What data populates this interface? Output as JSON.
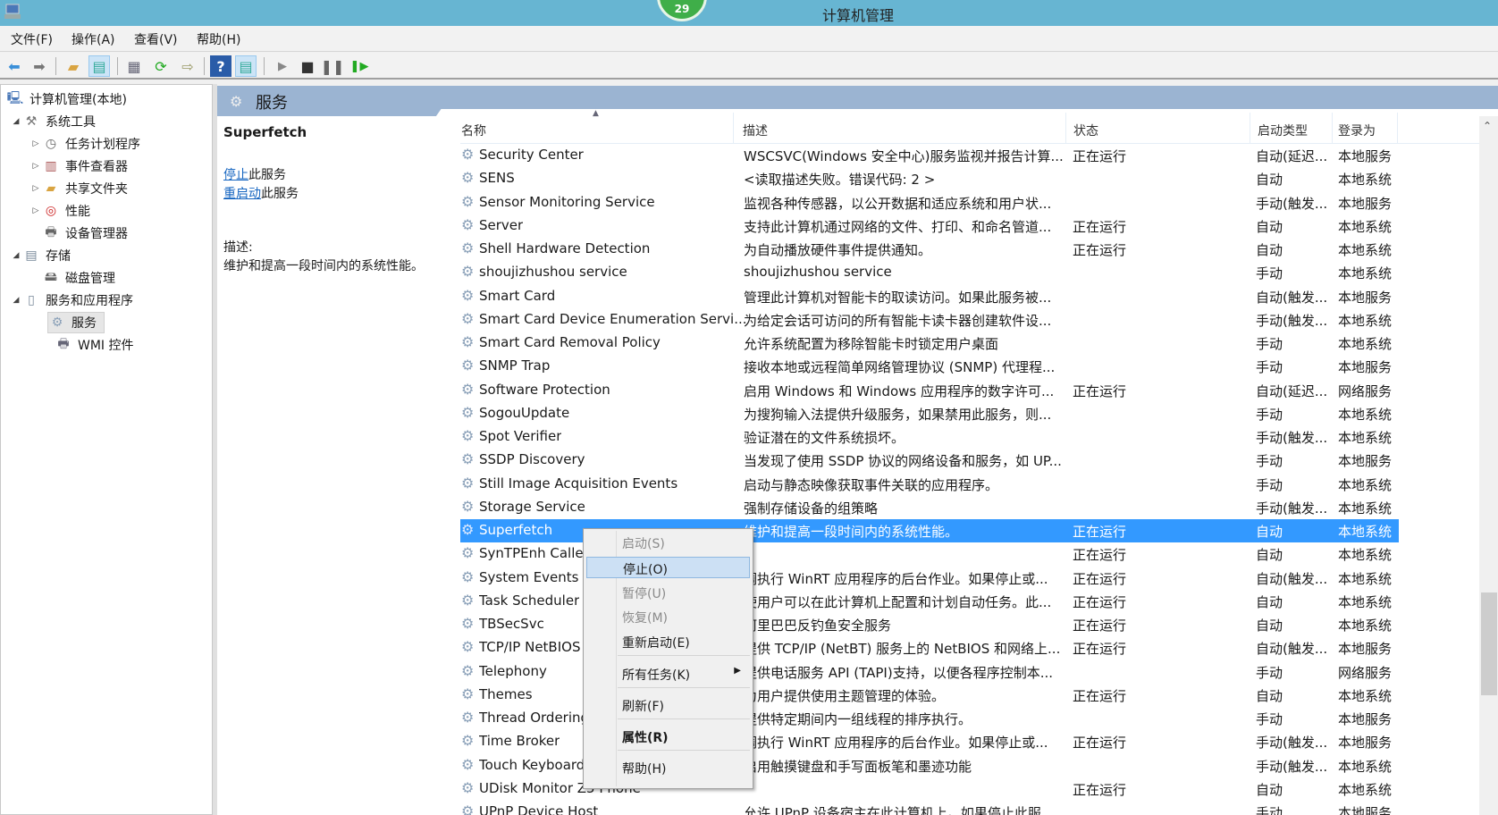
{
  "window": {
    "title": "计算机管理",
    "badge": "29"
  },
  "menu": [
    "文件(F)",
    "操作(A)",
    "查看(V)",
    "帮助(H)"
  ],
  "toolbar": [
    "back-icon",
    "forward-icon",
    "up-folder-icon",
    "show-hide-tree-icon",
    "properties-icon",
    "refresh-icon",
    "export-icon",
    "help-icon",
    "show-action-pane-icon",
    "start-service-icon",
    "stop-service-icon",
    "pause-service-icon",
    "restart-service-icon"
  ],
  "tree": {
    "root": "计算机管理(本地)",
    "items": [
      {
        "label": "系统工具",
        "level": 1,
        "expand": "open"
      },
      {
        "label": "任务计划程序",
        "level": 2,
        "expand": "closed"
      },
      {
        "label": "事件查看器",
        "level": 2,
        "expand": "closed"
      },
      {
        "label": "共享文件夹",
        "level": 2,
        "expand": "closed"
      },
      {
        "label": "性能",
        "level": 2,
        "expand": "closed"
      },
      {
        "label": "设备管理器",
        "level": 2,
        "expand": ""
      },
      {
        "label": "存储",
        "level": 1,
        "expand": "open"
      },
      {
        "label": "磁盘管理",
        "level": 2,
        "expand": ""
      },
      {
        "label": "服务和应用程序",
        "level": 1,
        "expand": "open"
      },
      {
        "label": "服务",
        "level": 2,
        "expand": "",
        "selected": true
      },
      {
        "label": "WMI 控件",
        "level": 2,
        "expand": ""
      }
    ]
  },
  "header": {
    "title": "服务"
  },
  "detail": {
    "service_name": "Superfetch",
    "stop_link": "停止",
    "stop_suffix": "此服务",
    "restart_link": "重启动",
    "restart_suffix": "此服务",
    "desc_label": "描述:",
    "desc": "维护和提高一段时间内的系统性能。"
  },
  "columns": {
    "name": "名称",
    "desc": "描述",
    "status": "状态",
    "startup": "启动类型",
    "logon": "登录为"
  },
  "rows": [
    {
      "name": "Security Center",
      "desc": "WSCSVC(Windows 安全中心)服务监视并报告计算...",
      "status": "正在运行",
      "startup": "自动(延迟...",
      "logon": "本地服务"
    },
    {
      "name": "SENS",
      "desc": "<读取描述失败。错误代码: 2 >",
      "status": "",
      "startup": "自动",
      "logon": "本地系统"
    },
    {
      "name": "Sensor Monitoring Service",
      "desc": "监视各种传感器，以公开数据和适应系统和用户状...",
      "status": "",
      "startup": "手动(触发...",
      "logon": "本地服务"
    },
    {
      "name": "Server",
      "desc": "支持此计算机通过网络的文件、打印、和命名管道...",
      "status": "正在运行",
      "startup": "自动",
      "logon": "本地系统"
    },
    {
      "name": "Shell Hardware Detection",
      "desc": "为自动播放硬件事件提供通知。",
      "status": "正在运行",
      "startup": "自动",
      "logon": "本地系统"
    },
    {
      "name": "shoujizhushou service",
      "desc": "shoujizhushou service",
      "status": "",
      "startup": "手动",
      "logon": "本地系统"
    },
    {
      "name": "Smart Card",
      "desc": "管理此计算机对智能卡的取读访问。如果此服务被...",
      "status": "",
      "startup": "自动(触发...",
      "logon": "本地服务"
    },
    {
      "name": "Smart Card Device Enumeration Servi...",
      "desc": "为给定会话可访问的所有智能卡读卡器创建软件设...",
      "status": "",
      "startup": "手动(触发...",
      "logon": "本地系统"
    },
    {
      "name": "Smart Card Removal Policy",
      "desc": "允许系统配置为移除智能卡时锁定用户桌面",
      "status": "",
      "startup": "手动",
      "logon": "本地系统"
    },
    {
      "name": "SNMP Trap",
      "desc": "接收本地或远程简单网络管理协议 (SNMP) 代理程...",
      "status": "",
      "startup": "手动",
      "logon": "本地服务"
    },
    {
      "name": "Software Protection",
      "desc": "启用 Windows 和 Windows 应用程序的数字许可...",
      "status": "正在运行",
      "startup": "自动(延迟...",
      "logon": "网络服务"
    },
    {
      "name": "SogouUpdate",
      "desc": "为搜狗输入法提供升级服务，如果禁用此服务，则...",
      "status": "",
      "startup": "手动",
      "logon": "本地系统"
    },
    {
      "name": "Spot Verifier",
      "desc": "验证潜在的文件系统损坏。",
      "status": "",
      "startup": "手动(触发...",
      "logon": "本地系统"
    },
    {
      "name": "SSDP Discovery",
      "desc": "当发现了使用 SSDP 协议的网络设备和服务，如 UP...",
      "status": "",
      "startup": "手动",
      "logon": "本地服务"
    },
    {
      "name": "Still Image Acquisition Events",
      "desc": "启动与静态映像获取事件关联的应用程序。",
      "status": "",
      "startup": "手动",
      "logon": "本地系统"
    },
    {
      "name": "Storage Service",
      "desc": "强制存储设备的组策略",
      "status": "",
      "startup": "手动(触发...",
      "logon": "本地系统"
    },
    {
      "name": "Superfetch",
      "desc": "维护和提高一段时间内的系统性能。",
      "status": "正在运行",
      "startup": "自动",
      "logon": "本地系统",
      "selected": true
    },
    {
      "name": "SynTPEnh Caller",
      "desc": "",
      "status": "正在运行",
      "startup": "自动",
      "logon": "本地系统"
    },
    {
      "name": "System Events B",
      "desc": "调执行 WinRT 应用程序的后台作业。如果停止或...",
      "status": "正在运行",
      "startup": "自动(触发...",
      "logon": "本地系统"
    },
    {
      "name": "Task Scheduler",
      "desc": "使用户可以在此计算机上配置和计划自动任务。此...",
      "status": "正在运行",
      "startup": "自动",
      "logon": "本地系统"
    },
    {
      "name": "TBSecSvc",
      "desc": "阿里巴巴反钓鱼安全服务",
      "status": "正在运行",
      "startup": "自动",
      "logon": "本地系统"
    },
    {
      "name": "TCP/IP NetBIOS",
      "desc": "提供 TCP/IP (NetBT) 服务上的 NetBIOS 和网络上...",
      "status": "正在运行",
      "startup": "自动(触发...",
      "logon": "本地服务"
    },
    {
      "name": "Telephony",
      "desc": "提供电话服务 API (TAPI)支持，以便各程序控制本...",
      "status": "",
      "startup": "手动",
      "logon": "网络服务"
    },
    {
      "name": "Themes",
      "desc": "为用户提供使用主题管理的体验。",
      "status": "正在运行",
      "startup": "自动",
      "logon": "本地系统"
    },
    {
      "name": "Thread Ordering",
      "desc": "提供特定期间内一组线程的排序执行。",
      "status": "",
      "startup": "手动",
      "logon": "本地服务"
    },
    {
      "name": "Time Broker",
      "desc": "调执行 WinRT 应用程序的后台作业。如果停止或...",
      "status": "正在运行",
      "startup": "手动(触发...",
      "logon": "本地服务"
    },
    {
      "name": "Touch Keyboard",
      "desc": "启用触摸键盘和手写面板笔和墨迹功能",
      "status": "",
      "startup": "手动(触发...",
      "logon": "本地系统"
    },
    {
      "name": "UDisk Monitor Z5 Phone",
      "desc": "",
      "status": "正在运行",
      "startup": "自动",
      "logon": "本地系统"
    },
    {
      "name": "UPnP Device Host",
      "desc": "允许 UPnP 设备宿主在此计算机上。如果停止此服...",
      "status": "",
      "startup": "手动",
      "logon": "本地服务"
    }
  ],
  "context_menu": [
    {
      "label": "启动(S)",
      "state": "disabled"
    },
    {
      "label": "停止(O)",
      "state": "highlighted"
    },
    {
      "label": "暂停(U)",
      "state": "disabled"
    },
    {
      "label": "恢复(M)",
      "state": "disabled"
    },
    {
      "label": "重新启动(E)",
      "state": "normal"
    },
    {
      "label": "所有任务(K)",
      "state": "submenu"
    },
    {
      "label": "刷新(F)",
      "state": "normal"
    },
    {
      "label": "属性(R)",
      "state": "bold"
    },
    {
      "label": "帮助(H)",
      "state": "normal"
    }
  ],
  "colors": {
    "titlebar": "#67b5d2",
    "selection": "#3399ff",
    "header_band": "#9bb4d2",
    "menu_highlight": "#cce0f4"
  }
}
